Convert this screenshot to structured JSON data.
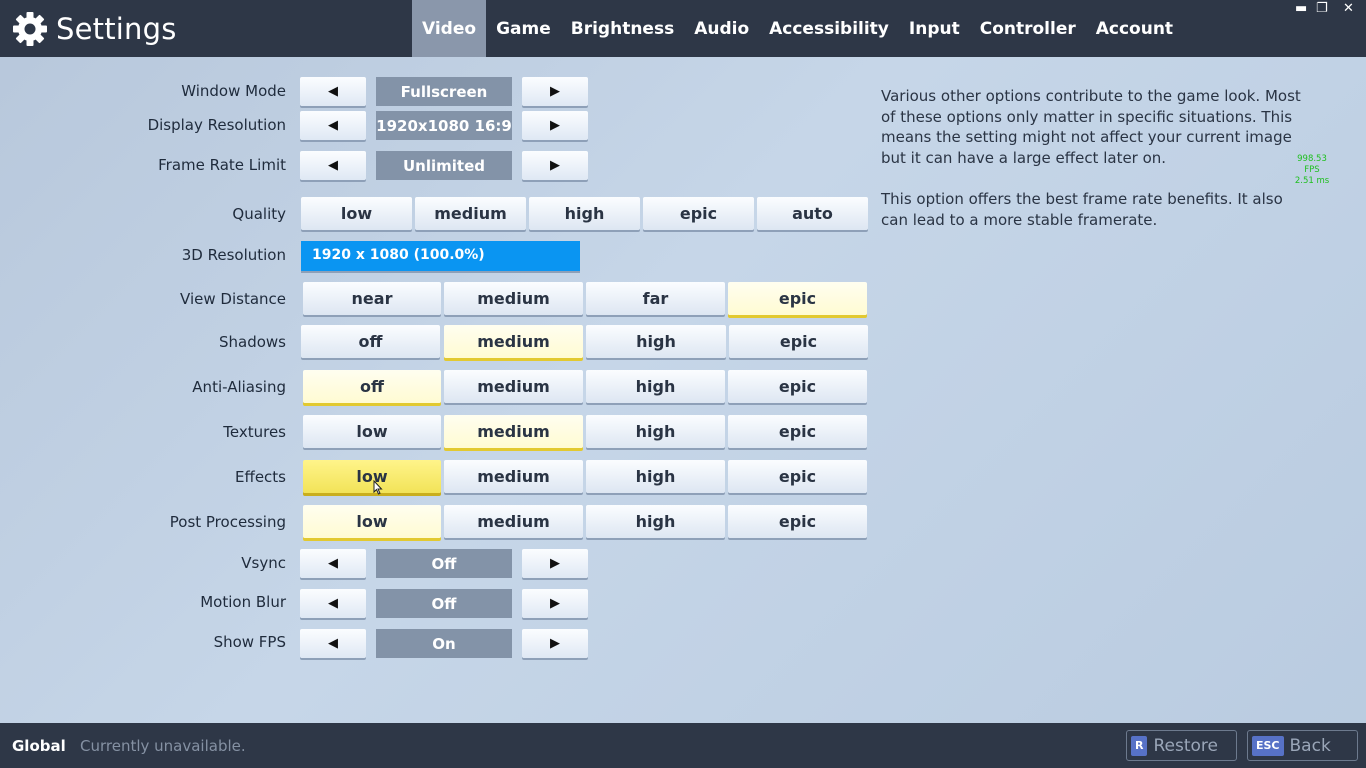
{
  "header": {
    "title": "Settings",
    "tabs": [
      "Video",
      "Game",
      "Brightness",
      "Audio",
      "Accessibility",
      "Input",
      "Controller",
      "Account"
    ],
    "active_tab": "Video",
    "window_controls": {
      "minimize": "▬",
      "restore": "❐",
      "close": "✕"
    }
  },
  "settings": {
    "window_mode": {
      "label": "Window Mode",
      "value": "Fullscreen"
    },
    "display_resolution": {
      "label": "Display Resolution",
      "value": "1920x1080 16:9"
    },
    "frame_rate_limit": {
      "label": "Frame Rate Limit",
      "value": "Unlimited"
    },
    "quality": {
      "label": "Quality",
      "options": [
        "low",
        "medium",
        "high",
        "epic",
        "auto"
      ]
    },
    "resolution_3d": {
      "label": "3D Resolution",
      "value": "1920 x 1080 (100.0%)",
      "percent": 100.0
    },
    "view_distance": {
      "label": "View Distance",
      "options": [
        "near",
        "medium",
        "far",
        "epic"
      ],
      "selected": "epic"
    },
    "shadows": {
      "label": "Shadows",
      "options": [
        "off",
        "medium",
        "high",
        "epic"
      ],
      "selected": "medium"
    },
    "anti_aliasing": {
      "label": "Anti-Aliasing",
      "options": [
        "off",
        "medium",
        "high",
        "epic"
      ],
      "selected": "off"
    },
    "textures": {
      "label": "Textures",
      "options": [
        "low",
        "medium",
        "high",
        "epic"
      ],
      "selected": "medium"
    },
    "effects": {
      "label": "Effects",
      "options": [
        "low",
        "medium",
        "high",
        "epic"
      ],
      "selected": "low",
      "hovered": "low"
    },
    "post_processing": {
      "label": "Post Processing",
      "options": [
        "low",
        "medium",
        "high",
        "epic"
      ],
      "selected": "low"
    },
    "vsync": {
      "label": "Vsync",
      "value": "Off"
    },
    "motion_blur": {
      "label": "Motion Blur",
      "value": "Off"
    },
    "show_fps": {
      "label": "Show FPS",
      "value": "On"
    }
  },
  "arrows": {
    "left": "◀",
    "right": "▶"
  },
  "description": {
    "p1": "Various other options contribute to the game look. Most of these options only matter in specific situations. This means the setting might not affect your current image but it can have a large effect later on.",
    "p2": "This option offers the best frame rate benefits. It also can lead to a more stable framerate."
  },
  "fps_counter": {
    "fps": "998.53 FPS",
    "ms": "2.51 ms"
  },
  "footer": {
    "scope": "Global",
    "status": "Currently unavailable.",
    "restore": {
      "key": "R",
      "label": "Restore"
    },
    "back": {
      "key": "ESC",
      "label": "Back"
    }
  },
  "colors": {
    "bar_bg": "#2e3747",
    "active_tab": "#8a97ab",
    "selected_option": "#fffbd2",
    "hovered_option": "#f2e358",
    "resolution_fill": "#0a95f2",
    "fps_text": "#1fbf1f"
  }
}
